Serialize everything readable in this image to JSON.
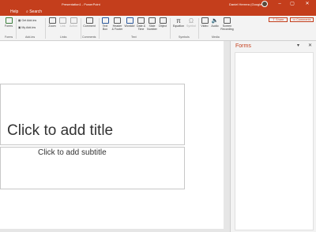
{
  "titlebar": {
    "doc_title": "Presentation1 - PowerPoint",
    "user": "Daniel Herrera (Google)",
    "min": "–",
    "max": "▢",
    "close": "✕"
  },
  "menubar": {
    "help": "Help",
    "search": "Search",
    "search_icon": "search-icon"
  },
  "ribbon": {
    "forms": "Forms",
    "get_addins": "Get Add-ins",
    "my_addins": "My Add-ins",
    "zoom": "Zoom",
    "link": "Link",
    "action": "Action",
    "comment": "Comment",
    "text_box": "Text Box",
    "header_footer": "Header & Footer",
    "wordart": "WordArt",
    "date_time": "Date & Time",
    "slide_number": "Slide Number",
    "object": "Object",
    "equation": "Equation",
    "symbol": "Symbol",
    "video": "Video",
    "audio": "Audio",
    "screen_recording": "Screen Recording",
    "groups": {
      "forms": "Forms",
      "addins": "Add-ins",
      "links": "Links",
      "comments": "Comments",
      "text": "Text",
      "symbols": "Symbols",
      "media": "Media"
    },
    "share": "Share",
    "comments_btn": "Comments"
  },
  "slide": {
    "title_placeholder": "Click to add title",
    "subtitle_placeholder": "Click to add subtitle"
  },
  "pane": {
    "title": "Forms",
    "options": "▾",
    "close": "✕"
  },
  "colors": {
    "accent": "#c43e1c"
  }
}
